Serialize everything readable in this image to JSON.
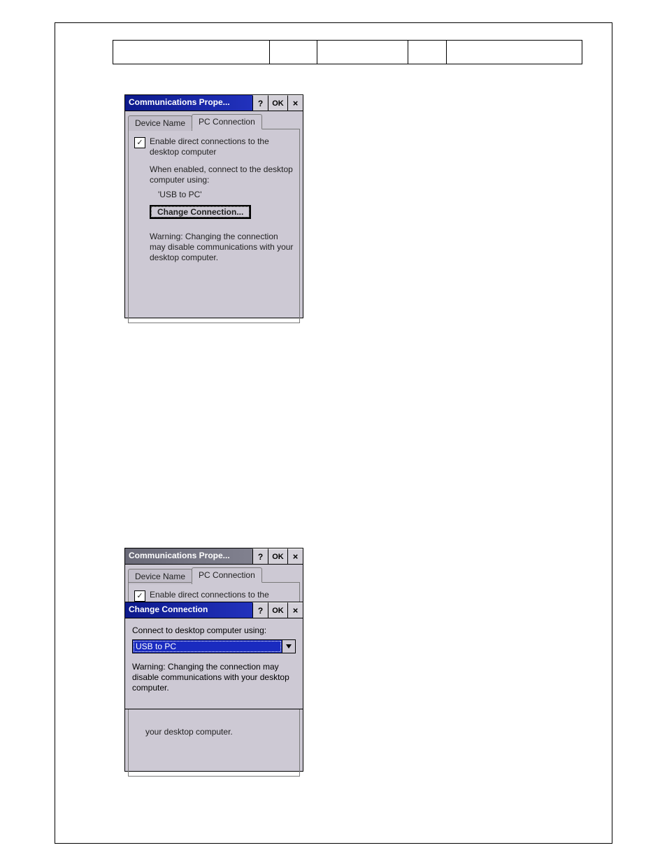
{
  "dialog1": {
    "title": "Communications Prope...",
    "help": "?",
    "ok": "OK",
    "close": "×",
    "tabs": {
      "device": "Device Name",
      "pc": "PC Connection"
    },
    "checkbox_label": "Enable direct connections to the desktop computer",
    "checked_glyph": "✓",
    "when_enabled": "When enabled, connect to the desktop computer using:",
    "connection_value": "'USB to PC'",
    "change_button": "Change Connection...",
    "warning": "Warning: Changing the connection may disable communications with your desktop computer."
  },
  "dialog2": {
    "title": "Communications Prope...",
    "help": "?",
    "ok": "OK",
    "close": "×",
    "tabs": {
      "device": "Device Name",
      "pc": "PC Connection"
    },
    "checkbox_label": "Enable direct connections to the",
    "checked_glyph": "✓",
    "peek_bottom": "your desktop computer."
  },
  "change_dialog": {
    "title": "Change Connection",
    "help": "?",
    "ok": "OK",
    "close": "×",
    "label": "Connect to desktop computer using:",
    "selected": "USB to PC",
    "warning": "Warning: Changing the connection may disable communications with your desktop computer."
  }
}
